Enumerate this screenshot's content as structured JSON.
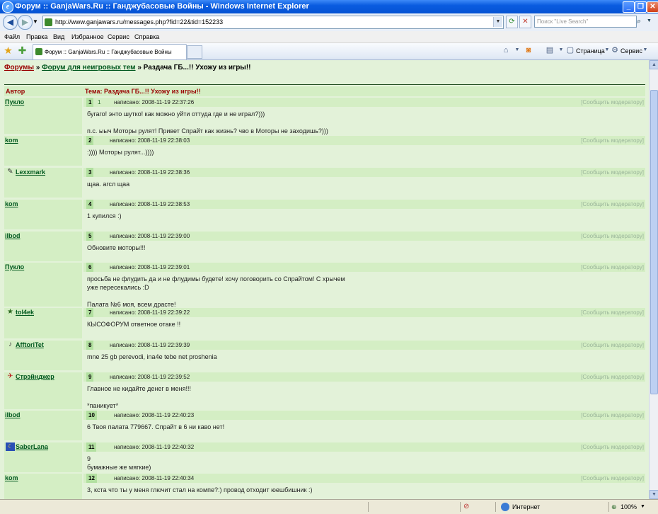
{
  "window": {
    "title": "Форум :: GanjaWars.Ru :: Ганджубасовые Войны - Windows Internet Explorer"
  },
  "address": {
    "url": "http://www.ganjawars.ru/messages.php?fid=22&tid=152233",
    "search_placeholder": "Поиск \"Live Search\""
  },
  "menu": [
    "Файл",
    "Правка",
    "Вид",
    "Избранное",
    "Сервис",
    "Справка"
  ],
  "tab": {
    "label": "Форум :: GanjaWars.Ru :: Ганджубасовые Войны"
  },
  "toolbar": {
    "page_label": "Страница",
    "tools_label": "Сервис"
  },
  "breadcrumb": {
    "forums": "Форумы",
    "sep1": "»",
    "section": "Форум для неигровых тем",
    "sep2": "»",
    "topic": "Раздача ГБ...!! Ухожу из игры!!"
  },
  "table_head": {
    "author": "Автор",
    "topic": "Тема: Раздача ГБ...!! Ухожу из игры!!"
  },
  "written_label": "написано:",
  "report_label": "[Сообщить модератору]",
  "posts": [
    {
      "num": "1",
      "extra": "1",
      "author": "Пукло",
      "date": "2008-11-19 22:37:26",
      "lines": "бугаго! энто шутко! как можно уйти оттуда где и не играл?)))\n\nп.с. ыыч Моторы рулят! Привет Спрайт как жизнь? чво в Моторы не заходишь?)))"
    },
    {
      "num": "2",
      "author": "kom",
      "date": "2008-11-19 22:38:03",
      "lines": ":)))) Моторы рулят...))))"
    },
    {
      "num": "3",
      "author": "Lexxmark",
      "date": "2008-11-19 22:38:36",
      "lines": "щаа. агсл щаа"
    },
    {
      "num": "4",
      "author": "kom",
      "date": "2008-11-19 22:38:53",
      "lines": "1 купился :)"
    },
    {
      "num": "5",
      "author": "ilbod",
      "date": "2008-11-19 22:39:00",
      "lines": "Обновите моторы!!!"
    },
    {
      "num": "6",
      "author": "Пукло",
      "date": "2008-11-19 22:39:01",
      "lines": "просьба не флудить да и не флудимы будете! хочу поговорить со Спрайтом! С хрычем\nуже пересекались :D\n\nПалата №6 моя, всем драсте!"
    },
    {
      "num": "7",
      "author": "tol4ek",
      "date": "2008-11-19 22:39:22",
      "lines": "КЫСОФОРУМ ответное отаке !!"
    },
    {
      "num": "8",
      "author": "AfftoriTet",
      "date": "2008-11-19 22:39:39",
      "lines": "mne 25 gb perevodi, ina4e tebe net proshenia"
    },
    {
      "num": "9",
      "author": "Стрэйнджер",
      "date": "2008-11-19 22:39:52",
      "lines": "Главное не кидайте денег в меня!!!\n\n*паникует*"
    },
    {
      "num": "10",
      "author": "ilbod",
      "date": "2008-11-19 22:40:23",
      "lines": "6 Твоя палата 779667. Спрайт в 6 ни каво нет!"
    },
    {
      "num": "11",
      "author": "SaberLana",
      "date": "2008-11-19 22:40:32",
      "lines": "9\nбумажные же мягкие)"
    },
    {
      "num": "12",
      "author": "kom",
      "date": "2008-11-19 22:40:34",
      "lines": "3, кста что ты у меня глючит стал на компе?:) провод отходит юешбишник :)"
    }
  ],
  "status": {
    "zone": "Интернет",
    "zoom": "100%"
  }
}
